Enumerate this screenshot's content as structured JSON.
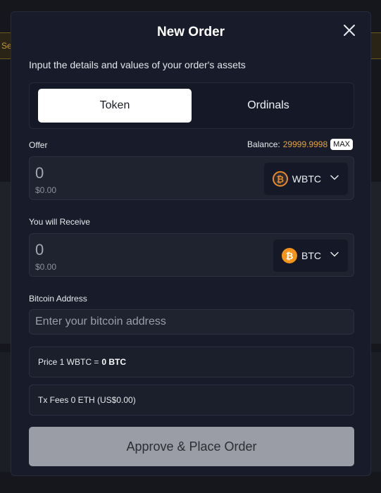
{
  "background": {
    "strip_text": "Se"
  },
  "modal": {
    "title": "New Order",
    "subtitle": "Input the details and values of your order's assets"
  },
  "tabs": [
    {
      "label": "Token",
      "active": true
    },
    {
      "label": "Ordinals",
      "active": false
    }
  ],
  "offer": {
    "label": "Offer",
    "balance_label": "Balance:",
    "balance_value": "29999.9998",
    "max_label": "MAX",
    "amount": "0",
    "usd": "$0.00",
    "token": "WBTC",
    "token_icon": "wbtc-coin-icon"
  },
  "receive": {
    "label": "You will Receive",
    "amount": "0",
    "usd": "$0.00",
    "token": "BTC",
    "token_icon": "btc-coin-icon"
  },
  "address": {
    "label": "Bitcoin Address",
    "placeholder": "Enter your bitcoin address",
    "value": ""
  },
  "price": {
    "prefix": "Price 1 WBTC =",
    "value": "0 BTC"
  },
  "fees": {
    "text": "Tx Fees 0 ETH (US$0.00)"
  },
  "submit_label": "Approve & Place Order",
  "colors": {
    "accent_orange": "#e6a23c",
    "modal_bg": "#181c2a",
    "button_disabled": "#9a9ca6"
  }
}
